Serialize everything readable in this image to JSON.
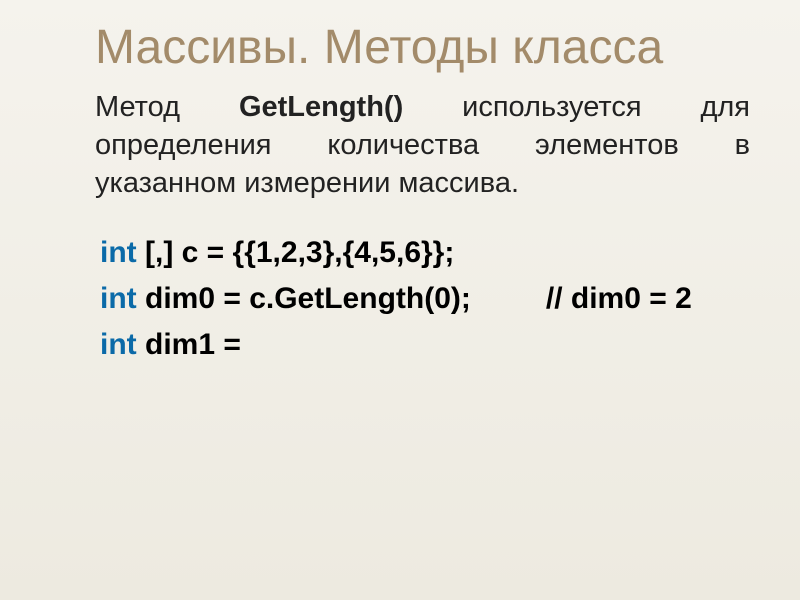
{
  "title": "Массивы. Методы класса",
  "description_pre": "Метод ",
  "description_bold": "GetLength()",
  "description_post": " используется для определения количества элементов в указанном измерении массива.",
  "code": {
    "kw": "int",
    "line1_rest": " [,] c = {{1,2,3},{4,5,6}};",
    "line2_rest": " dim0 = c.GetLength(0);     // dim0 = 2",
    "line3_rest": " dim1 ="
  }
}
